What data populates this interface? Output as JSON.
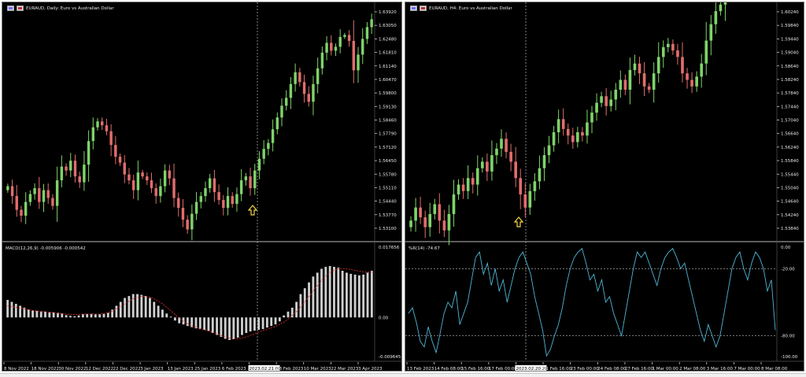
{
  "colors": {
    "bg": "#000000",
    "text": "#e8e8e8",
    "bull": "#7fd36a",
    "bear": "#e26d6d",
    "macd_hist": "#d0d0d0",
    "macd_signal": "#d03030",
    "wpr_line": "#4fb6d6",
    "grid_dash": "#bdbdbd",
    "arrow": "#f5d547",
    "border": "#7a7a7a"
  },
  "left": {
    "title": "EURAUD, Daily:  Euro vs Australian Dollar",
    "icons": [
      "chart-window-icon",
      "symbol-flag-icon"
    ],
    "price_ticks": [
      "1.63920",
      "1.63050",
      "1.62480",
      "1.61810",
      "1.61140",
      "1.60470",
      "1.59800",
      "1.59130",
      "1.58460",
      "1.57790",
      "1.57120",
      "1.56450",
      "1.55780",
      "1.55110",
      "1.54440",
      "1.53770",
      "1.53100"
    ],
    "macd_label": "MACD(12,26,9) -0.005906 -0.000542",
    "macd_ticks": [
      "0.017656",
      "0.00",
      "-0.009645"
    ],
    "date_ticks": [
      "8 Nov 2022",
      "18 Nov 2022",
      "30 Nov 2022",
      "12 Dec 2022",
      "22 Dec 2022",
      "3 Jan 2023",
      "13 Jan 2023",
      "25 Jan 2023",
      "6 Feb 2023",
      "2023.02.21 00:00",
      "28 Feb 2023",
      "10 Mar 2023",
      "22 Mar 2023",
      "3 Apr 2023"
    ],
    "arrow": "up-arrow-icon"
  },
  "right": {
    "title": "EURAUD, H4:  Euro vs Australian Dollar",
    "icons": [
      "chart-window-icon",
      "symbol-flag-icon"
    ],
    "price_ticks": [
      "1.60240",
      "1.59840",
      "1.59440",
      "1.59040",
      "1.58640",
      "1.58240",
      "1.57840",
      "1.57440",
      "1.57040",
      "1.56640",
      "1.56240",
      "1.55840",
      "1.55440",
      "1.55040",
      "1.54640",
      "1.54240",
      "1.53840"
    ],
    "wpr_label": "%R(14) -74.67",
    "wpr_ticks": [
      "0.00",
      "-20.00",
      "-80.00",
      "-100.00"
    ],
    "date_ticks": [
      "13 Feb 2023",
      "14 Feb 08:00",
      "15 Feb 16:00",
      "17 Feb 00:00",
      "2023.02.20 20:00",
      "21 Feb 16:00",
      "23 Feb 00:00",
      "24 Feb 08:00",
      "27 Feb 16:00",
      "1 Mar 00:00",
      "2 Mar 08:00",
      "3 Mar 16:00",
      "7 Mar 00:00",
      "8 Mar 08:00"
    ],
    "arrow": "up-arrow-icon"
  },
  "chart_data": [
    {
      "type": "candlestick",
      "title": "EURAUD, Daily:  Euro vs Australian Dollar",
      "y_ticks": [
        "1.63920",
        "1.63050",
        "1.62480",
        "1.61810",
        "1.61140",
        "1.60470",
        "1.59800",
        "1.59130",
        "1.58460",
        "1.57790",
        "1.57120",
        "1.56450",
        "1.55780",
        "1.55110",
        "1.54440",
        "1.53770",
        "1.53100"
      ],
      "ylim": [
        1.528,
        1.641
      ],
      "x_ticks": [
        "8 Nov 2022",
        "18 Nov 2022",
        "30 Nov 2022",
        "12 Dec 2022",
        "22 Dec 2022",
        "3 Jan 2023",
        "13 Jan 2023",
        "25 Jan 2023",
        "6 Feb 2023",
        "2023.02.21 00:00",
        "28 Feb 2023",
        "10 Mar 2023",
        "22 Mar 2023",
        "3 Apr 2023"
      ],
      "close_path": [
        1.553,
        1.548,
        1.541,
        1.538,
        1.545,
        1.549,
        1.552,
        1.545,
        1.551,
        1.547,
        1.543,
        1.556,
        1.563,
        1.561,
        1.566,
        1.558,
        1.555,
        1.564,
        1.576,
        1.583,
        1.586,
        1.584,
        1.581,
        1.574,
        1.568,
        1.565,
        1.559,
        1.556,
        1.551,
        1.56,
        1.558,
        1.556,
        1.552,
        1.548,
        1.553,
        1.561,
        1.557,
        1.547,
        1.542,
        1.536,
        1.531,
        1.539,
        1.545,
        1.548,
        1.552,
        1.557,
        1.55,
        1.546,
        1.542,
        1.548,
        1.544,
        1.549,
        1.556,
        1.558,
        1.552,
        1.561,
        1.567,
        1.572,
        1.575,
        1.582,
        1.588,
        1.594,
        1.598,
        1.605,
        1.611,
        1.606,
        1.6,
        1.596,
        1.605,
        1.613,
        1.621,
        1.626,
        1.622,
        1.624,
        1.629,
        1.63,
        1.627,
        1.612,
        1.62,
        1.628,
        1.634,
        1.638
      ],
      "annotation": "up-arrow at 2023.02.21"
    },
    {
      "type": "bar",
      "name": "MACD(12,26,9)",
      "title": "MACD(12,26,9) -0.005906 -0.000542",
      "ylim": [
        -0.009645,
        0.017656
      ],
      "values": [
        0.0045,
        0.004,
        0.0035,
        0.003,
        0.0025,
        0.002,
        0.0018,
        0.0017,
        0.0016,
        0.0015,
        0.0014,
        0.0013,
        0.0012,
        0.001,
        0.0006,
        0.0004,
        0.0003,
        0.0005,
        0.0008,
        0.0009,
        0.0009,
        0.0008,
        0.0008,
        0.0009,
        0.0012,
        0.002,
        0.003,
        0.004,
        0.005,
        0.0055,
        0.006,
        0.006,
        0.0058,
        0.0055,
        0.005,
        0.004,
        0.003,
        0.002,
        0.001,
        0.0002,
        -0.0008,
        -0.0015,
        -0.0018,
        -0.0022,
        -0.0025,
        -0.0028,
        -0.003,
        -0.0032,
        -0.0035,
        -0.004,
        -0.0045,
        -0.005,
        -0.0055,
        -0.0058,
        -0.0056,
        -0.0052,
        -0.0045,
        -0.004,
        -0.0036,
        -0.0034,
        -0.0032,
        -0.003,
        -0.0026,
        -0.0022,
        -0.0018,
        -0.001,
        0.0005,
        0.0015,
        0.0025,
        0.004,
        0.006,
        0.0075,
        0.009,
        0.0105,
        0.0115,
        0.0125,
        0.013,
        0.0132,
        0.013,
        0.0128,
        0.012,
        0.0115,
        0.0112,
        0.011,
        0.0108,
        0.011,
        0.0115,
        0.012
      ],
      "signal": [
        0.003,
        0.0028,
        0.0026,
        0.0024,
        0.0022,
        0.002,
        0.0018,
        0.0016,
        0.0015,
        0.0014,
        0.0013,
        0.0012,
        0.0011,
        0.001,
        0.0009,
        0.0008,
        0.0008,
        0.0008,
        0.0009,
        0.0009,
        0.0009,
        0.0009,
        0.0009,
        0.001,
        0.0012,
        0.0016,
        0.0022,
        0.0028,
        0.0035,
        0.0042,
        0.0048,
        0.0052,
        0.0054,
        0.0054,
        0.0052,
        0.0048,
        0.0042,
        0.0035,
        0.0026,
        0.0017,
        0.0008,
        -0.0002,
        -0.001,
        -0.0016,
        -0.0021,
        -0.0025,
        -0.0029,
        -0.0032,
        -0.0035,
        -0.0038,
        -0.0042,
        -0.0046,
        -0.005,
        -0.0053,
        -0.0055,
        -0.0055,
        -0.0053,
        -0.005,
        -0.0046,
        -0.0042,
        -0.0038,
        -0.0034,
        -0.0031,
        -0.0027,
        -0.0023,
        -0.0018,
        -0.0012,
        -0.0004,
        0.0005,
        0.0015,
        0.0027,
        0.004,
        0.0054,
        0.0068,
        0.0082,
        0.0095,
        0.0106,
        0.0115,
        0.0121,
        0.0125,
        0.0126,
        0.0125,
        0.0123,
        0.0121,
        0.0119,
        0.0117,
        0.0116,
        0.0117
      ]
    },
    {
      "type": "candlestick",
      "title": "EURAUD, H4:  Euro vs Australian Dollar",
      "y_ticks": [
        "1.60240",
        "1.59840",
        "1.59440",
        "1.59040",
        "1.58640",
        "1.58240",
        "1.57840",
        "1.57440",
        "1.57040",
        "1.56640",
        "1.56240",
        "1.55840",
        "1.55440",
        "1.55040",
        "1.54640",
        "1.54240",
        "1.53840"
      ],
      "ylim": [
        1.5355,
        1.6038
      ],
      "x_ticks": [
        "13 Feb 2023",
        "14 Feb 08:00",
        "15 Feb 16:00",
        "17 Feb 00:00",
        "2023.02.20 20:00",
        "21 Feb 16:00",
        "23 Feb 00:00",
        "24 Feb 08:00",
        "27 Feb 16:00",
        "1 Mar 00:00",
        "2 Mar 08:00",
        "3 Mar 16:00",
        "7 Mar 00:00",
        "8 Mar 08:00"
      ],
      "close_path": [
        1.54,
        1.544,
        1.541,
        1.538,
        1.542,
        1.545,
        1.54,
        1.537,
        1.542,
        1.548,
        1.551,
        1.549,
        1.553,
        1.551,
        1.556,
        1.558,
        1.555,
        1.56,
        1.562,
        1.565,
        1.561,
        1.558,
        1.553,
        1.548,
        1.544,
        1.549,
        1.552,
        1.556,
        1.56,
        1.563,
        1.567,
        1.571,
        1.568,
        1.566,
        1.564,
        1.567,
        1.566,
        1.57,
        1.573,
        1.576,
        1.578,
        1.575,
        1.577,
        1.58,
        1.583,
        1.58,
        1.586,
        1.588,
        1.585,
        1.581,
        1.58,
        1.585,
        1.59,
        1.593,
        1.594,
        1.592,
        1.59,
        1.585,
        1.583,
        1.581,
        1.584,
        1.588,
        1.595,
        1.6,
        1.604,
        1.606,
        1.613,
        1.62,
        1.625,
        1.629,
        1.633,
        1.632,
        1.629,
        1.631,
        1.628,
        1.625,
        1.628
      ],
      "annotation": "up-arrow at 2023.02.20 20:00"
    },
    {
      "type": "line",
      "name": "%R(14)",
      "title": "%R(14) -74.67",
      "ylim": [
        -100,
        0
      ],
      "y_ticks": [
        "0.00",
        "-20.00",
        "-80.00",
        "-100.00"
      ],
      "values": [
        -60,
        -55,
        -68,
        -85,
        -90,
        -72,
        -85,
        -95,
        -78,
        -60,
        -50,
        -55,
        -40,
        -70,
        -60,
        -50,
        -30,
        -10,
        -5,
        -25,
        -15,
        -35,
        -20,
        -40,
        -30,
        -50,
        -35,
        -20,
        -10,
        -5,
        -15,
        -25,
        -45,
        -60,
        -75,
        -98,
        -92,
        -80,
        -70,
        -55,
        -35,
        -20,
        -10,
        -5,
        -2,
        -15,
        -30,
        -25,
        -40,
        -30,
        -50,
        -45,
        -60,
        -70,
        -80,
        -60,
        -40,
        -20,
        -5,
        -10,
        -5,
        -15,
        -25,
        -35,
        -20,
        -10,
        -5,
        -2,
        -10,
        -20,
        -15,
        -30,
        -45,
        -60,
        -75,
        -85,
        -70,
        -80,
        -90,
        -80,
        -60,
        -40,
        -20,
        -10,
        -5,
        -20,
        -30,
        -15,
        -5,
        -10,
        -20,
        -40,
        -30,
        -75
      ]
    }
  ]
}
